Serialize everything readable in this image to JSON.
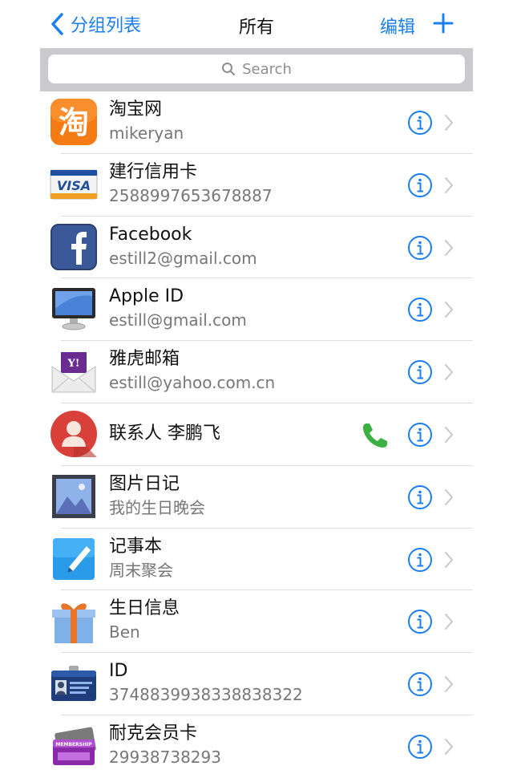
{
  "nav": {
    "back_label": "分组列表",
    "title": "所有",
    "edit_label": "编辑",
    "add_icon": "plus-icon"
  },
  "search": {
    "placeholder": "Search"
  },
  "colors": {
    "accent": "#1a7ef0",
    "phone": "#3cb043",
    "separator": "#dedee2"
  },
  "items": [
    {
      "title": "淘宝网",
      "subtitle": "mikeryan",
      "icon": "taobao-logo-icon"
    },
    {
      "title": "建行信用卡",
      "subtitle": "2588997653678887",
      "icon": "visa-card-icon"
    },
    {
      "title": "Facebook",
      "subtitle": "estill2@gmail.com",
      "icon": "facebook-logo-icon"
    },
    {
      "title": "Apple ID",
      "subtitle": "estill@gmail.com",
      "icon": "monitor-icon"
    },
    {
      "title": "雅虎邮箱",
      "subtitle": "estill@yahoo.com.cn",
      "icon": "yahoo-mail-icon"
    },
    {
      "title": "联系人 李鹏飞",
      "subtitle": "",
      "icon": "contact-avatar-icon"
    },
    {
      "title": "图片日记",
      "subtitle": "我的生日晚会",
      "icon": "picture-icon"
    },
    {
      "title": "记事本",
      "subtitle": "周末聚会",
      "icon": "notepad-icon"
    },
    {
      "title": "生日信息",
      "subtitle": "Ben",
      "icon": "gift-icon"
    },
    {
      "title": "ID",
      "subtitle": "374883993833883832​2",
      "icon": "id-card-icon"
    },
    {
      "title": "耐克会员卡",
      "subtitle": "29938738293",
      "icon": "membership-card-icon"
    }
  ]
}
